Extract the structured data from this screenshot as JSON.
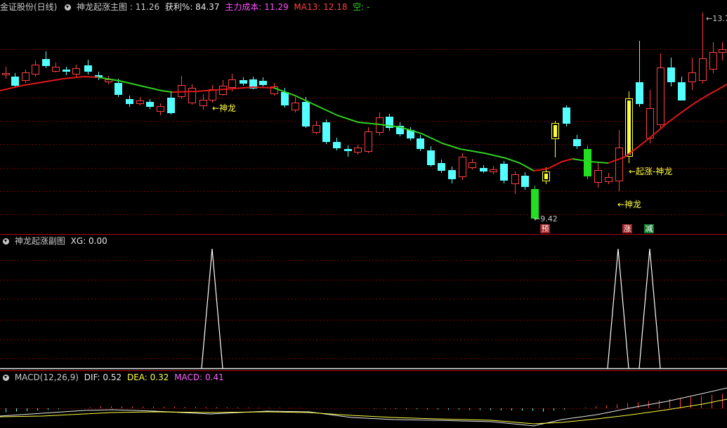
{
  "main": {
    "stock_name": "金证股份(日线)",
    "indicator_name": "神龙起涨主图",
    "price": ": 11.26",
    "profit_label": "获利%: 84.37",
    "cost_label": "主力成本: 11.29",
    "ma13_label": "MA13: 12.18",
    "kong_label": "空: -",
    "high_label": "13.7",
    "low_label": "9.42",
    "annotations": [
      "←神龙",
      "←起涨-神龙",
      "←神龙"
    ],
    "badges": [
      {
        "text": "预",
        "color": "#c04040"
      },
      {
        "text": "涨",
        "color": "#c04040"
      },
      {
        "text": "减",
        "color": "#20a040"
      }
    ]
  },
  "sub": {
    "indicator_name": "神龙起涨副图",
    "xg_label": "XG: 0.00"
  },
  "macd": {
    "title": "MACD(12,26,9)",
    "dif_label": "DIF: 0.52",
    "dea_label": "DEA: 0.32",
    "macd_label": "MACD: 0.41"
  },
  "colors": {
    "up": "#ff4040",
    "down": "#54ffff",
    "ma_up": "#e01818",
    "ma_down": "#30d020",
    "signal": "#ffff30",
    "grid": "#7a0000",
    "macd_pink": "#ff60ff"
  }
}
